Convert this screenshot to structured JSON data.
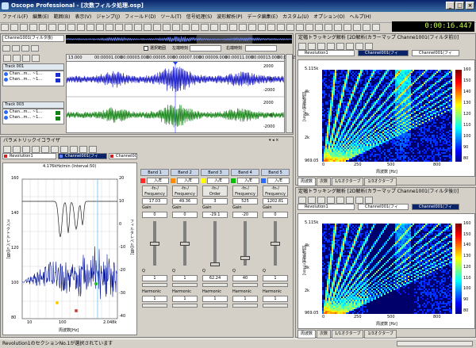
{
  "window": {
    "title": "Oscope Professional - [次数フィルタ処理.osp]"
  },
  "menu": [
    "ファイル(F)",
    "編集(E)",
    "範囲(B)",
    "表示(V)",
    "ジャンプ(J)",
    "フィールド(D)",
    "ツール(T)",
    "信号処理(S)",
    "波形解析(P)",
    "データ編集(E)",
    "カスタム(U)",
    "オプション(O)",
    "ヘルプ(H)"
  ],
  "transport": {
    "time": "0:00:16.447"
  },
  "waveview": {
    "channel_label": "Channe1001(フィルタ後)",
    "check_label": "選択範囲",
    "left_label": "左端時刻",
    "right_label": "右端時刻",
    "ruler": [
      "13.000",
      "00:00001.000",
      "00:00003.000",
      "00:00005.000",
      "00:00007.000",
      "00:00009.000",
      "00:00011.000",
      "00:00013.000",
      "00:00015.000"
    ],
    "track1": {
      "name": "Track 001",
      "rows": [
        "Chan...m... ~1...",
        "Chan...m... ~1..."
      ]
    },
    "track2": {
      "name": "Track 003",
      "rows": [
        "Chan...m... ~1...",
        "Chan...m... ~1..."
      ]
    },
    "yticks1": [
      "2000",
      "0",
      "-2000"
    ],
    "yticks2": [
      "2000",
      "0",
      "-2000"
    ]
  },
  "eq": {
    "title": "パラメトリックイコライザ",
    "tabs": [
      "Revolution1",
      "Channel001(フィ",
      "Channel001(フィ"
    ],
    "plot_title": "4.176kHz/min (Interval:50)",
    "ylabel": "スペクトルレベル[dB]",
    "y2label": "フィルタレベル[dB]",
    "xlabel": "周波数[Hz]",
    "yticks": [
      "160",
      "140",
      "120",
      "100",
      "80"
    ],
    "y2ticks": [
      "20",
      "10",
      "0",
      "-10",
      "-20",
      "-30",
      "-40"
    ],
    "xticks": [
      "10",
      "100",
      "2.048k"
    ],
    "bands": [
      {
        "name": "Band 1",
        "type": "入/E",
        "mode": "Frequency",
        "freq": "17.03",
        "gain_label": "Gain",
        "gain": "0",
        "q": "1",
        "harmonic": "1",
        "color": "#ff2a2a"
      },
      {
        "name": "Band 2",
        "type": "入/E",
        "mode": "Frequency",
        "freq": "49.36",
        "gain_label": "Gain",
        "gain": "0",
        "q": "1",
        "harmonic": "1",
        "color": "#ff8c00"
      },
      {
        "name": "Band 3",
        "type": "入/E",
        "mode": "Order",
        "freq": "3",
        "gain_label": "Gain",
        "gain": "-29.1",
        "q": "62.24",
        "harmonic": "1",
        "color": "#ffff00"
      },
      {
        "name": "Band 4",
        "type": "入/E",
        "mode": "Frequency",
        "freq": "525",
        "gain_label": "Gain",
        "gain": "-20",
        "q": "40",
        "harmonic": "1",
        "color": "#00c000"
      },
      {
        "name": "Band 5",
        "type": "入/E",
        "mode": "Frequency",
        "freq": "1202.81",
        "gain_label": "Gain",
        "gain": "0",
        "q": "1",
        "harmonic": "1",
        "color": "#2a6aff"
      }
    ],
    "q_label": "Q",
    "harmonic_label": "Harmonic",
    "mode_symbol": "-fn-/"
  },
  "spec1": {
    "title": "定幅トラッキング解析 [2D解析(カラーマップ Channe1001(フィルタ前))]",
    "tabs": [
      "Revolution1",
      "Channel001(フィ",
      "Channel001(フィ"
    ],
    "ylabel": "回転速度[r/min]",
    "xlabel": "周波数 [Hz]",
    "yticks": [
      "5.115k",
      "4k",
      "3k",
      "2k",
      "969.05"
    ],
    "xticks": [
      "0",
      "250",
      "500",
      "800"
    ],
    "cticks": [
      "160",
      "150",
      "140",
      "130",
      "120",
      "110",
      "100",
      "90",
      "80"
    ],
    "bottom_tabs": [
      "周波数",
      "次数",
      "1/1オクターブ",
      "1/3オクターブ"
    ]
  },
  "spec2": {
    "title": "定幅トラッキング解析 [2D解析(カラーマップ Channe1001(フィルタ後))]",
    "tabs": [
      "Revolution1",
      "Channel001(フィ",
      "Channel001(フィ"
    ],
    "ylabel": "回転速度[r/min]",
    "xlabel": "周波数 [Hz]",
    "yticks": [
      "5.115k",
      "4k",
      "3k",
      "2k",
      "969.05"
    ],
    "xticks": [
      "0",
      "250",
      "500",
      "800"
    ],
    "cticks": [
      "160",
      "150",
      "140",
      "130",
      "120",
      "110",
      "100",
      "90",
      "80"
    ],
    "bottom_tabs": [
      "周波数",
      "次数",
      "1/1オクターブ",
      "1/3オクターブ"
    ]
  },
  "status": {
    "text": "Revolution1のセクションNo.1が選択されています"
  }
}
